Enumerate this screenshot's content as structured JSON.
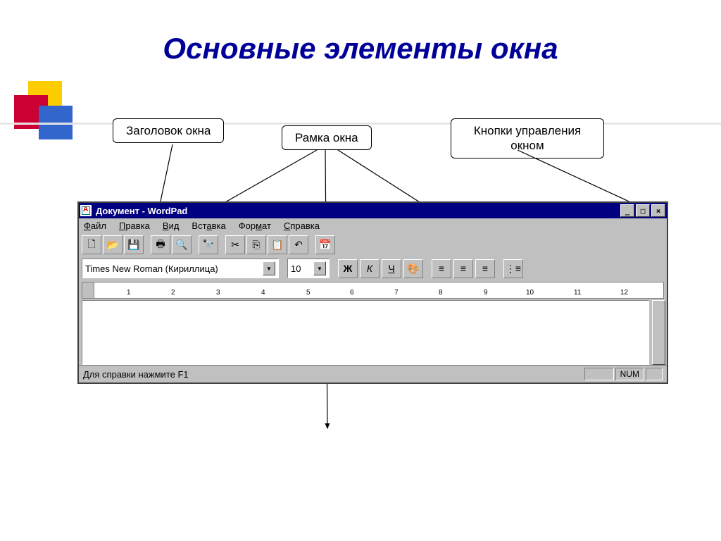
{
  "slide": {
    "title": "Основные элементы окна"
  },
  "labels": {
    "window_title": "Заголовок окна",
    "window_frame": "Рамка окна",
    "control_buttons": "Кнопки управления окном"
  },
  "app": {
    "title": "Документ - WordPad",
    "menu": {
      "file": "Файл",
      "edit": "Правка",
      "view": "Вид",
      "insert": "Вставка",
      "format": "Формат",
      "help": "Справка"
    },
    "font_name": "Times New Roman (Кириллица)",
    "font_size": "10",
    "format_buttons": {
      "bold": "Ж",
      "italic": "К",
      "underline": "Ч"
    },
    "ruler_labels": [
      "1",
      "2",
      "3",
      "4",
      "5",
      "6",
      "7",
      "8",
      "9",
      "10",
      "11",
      "12"
    ],
    "status": "Для справки нажмите F1",
    "status_num": "NUM"
  },
  "icons": {
    "new": "🗋",
    "open": "📂",
    "save": "💾",
    "print": "🖶",
    "preview": "🔍",
    "find": "🔭",
    "cut": "✂",
    "copy": "⎘",
    "paste": "📋",
    "undo": "↶",
    "datetime": "📅",
    "color": "🎨",
    "align_left": "≡",
    "align_center": "≡",
    "align_right": "≡",
    "bullets": "⋮≡",
    "dropdown": "▼",
    "minimize": "_",
    "maximize": "□",
    "close": "×"
  }
}
